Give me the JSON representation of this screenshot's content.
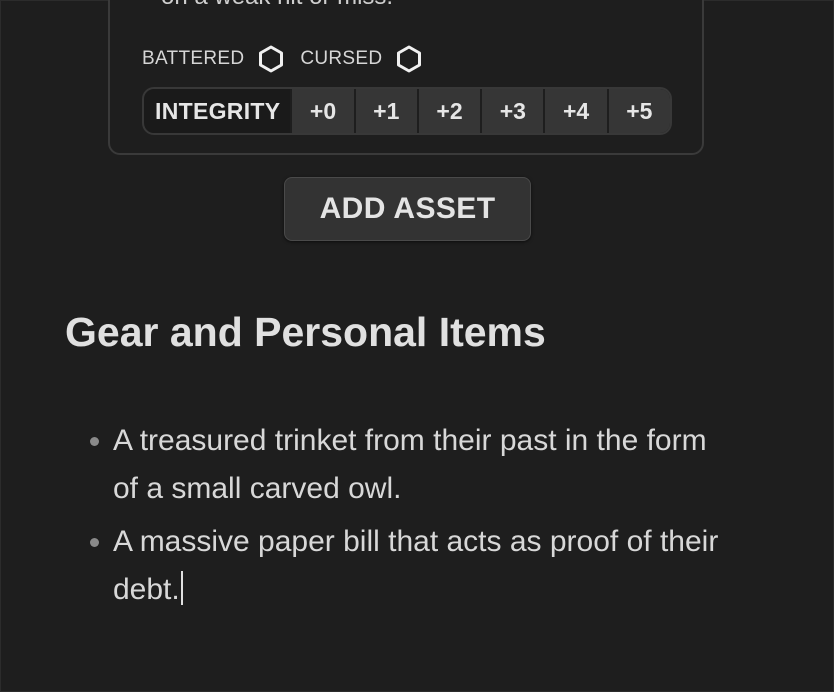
{
  "asset": {
    "cut_off_text": "on a weak hit or miss.",
    "conditions": [
      {
        "label": "BATTERED",
        "icon": "hexagon-icon",
        "checked": false
      },
      {
        "label": "CURSED",
        "icon": "hexagon-icon",
        "checked": false
      }
    ],
    "track": {
      "label": "INTEGRITY",
      "steps": [
        "+0",
        "+1",
        "+2",
        "+3",
        "+4",
        "+5"
      ]
    }
  },
  "add_asset_label": "ADD ASSET",
  "gear": {
    "heading": "Gear and Personal Items",
    "items": [
      "A treasured trinket from their past in the form of a small carved owl.",
      "A massive paper bill that acts as proof of their debt."
    ]
  },
  "colors": {
    "background": "#1e1e1e",
    "button": "#333333",
    "track_step": "#363636",
    "text": "#dcdcdc"
  }
}
